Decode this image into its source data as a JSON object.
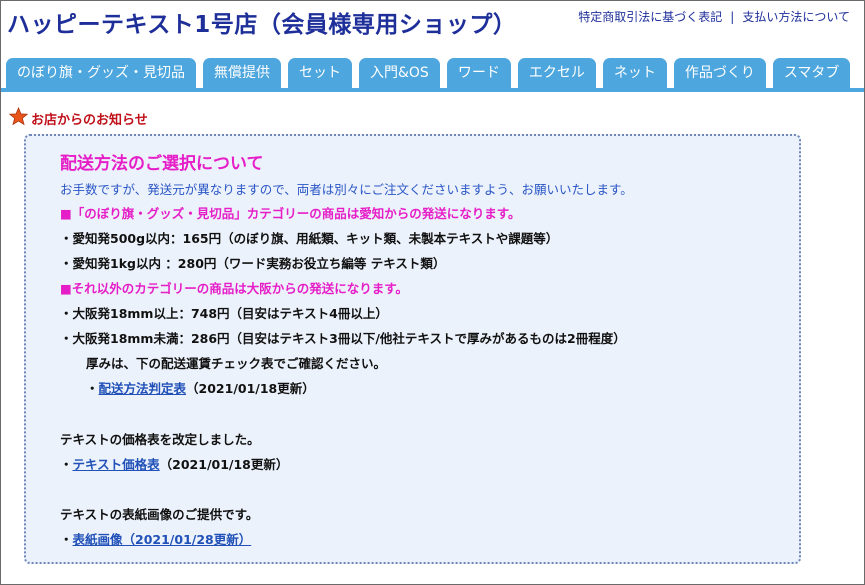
{
  "header": {
    "title": "ハッピーテキスト1号店（会員様専用ショップ）",
    "links": [
      "特定商取引法に基づく表記",
      "支払い方法について"
    ],
    "separator": "|"
  },
  "tabs": [
    "のぼり旗・グッズ・見切品",
    "無償提供",
    "セット",
    "入門&OS",
    "ワード",
    "エクセル",
    "ネット",
    "作品づくり",
    "スマタブ"
  ],
  "notice": {
    "heading": "お店からのお知らせ",
    "title": "配送方法のご選択について",
    "intro": "お手数ですが、発送元が異なりますので、両者は別々にご注文くださいますよう、お願いいたします。",
    "aichi_header": "■「のぼり旗・グッズ・見切品」カテゴリーの商品は愛知からの発送になります。",
    "aichi_500g": "・愛知発500g以内：165円（のぼり旗、用紙類、キット類、未製本テキストや課題等）",
    "aichi_1kg": "・愛知発1kg以内 ：280円（ワード実務お役立ち編等 テキスト類）",
    "osaka_header": "■それ以外のカテゴリーの商品は大阪からの発送になります。",
    "osaka_over": "・大阪発18mm以上：748円（目安はテキスト4冊以上）",
    "osaka_under": "・大阪発18mm未満：286円（目安はテキスト3冊以下/他社テキストで厚みがあるものは2冊程度）",
    "thickness_note": "厚みは、下の配送運賃チェック表でご確認ください。",
    "shipping_table_bullet": "・",
    "shipping_table_link": "配送方法判定表",
    "shipping_table_date": "（2021/01/18更新）",
    "price_revised": "テキストの価格表を改定しました。",
    "price_bullet": "・",
    "price_link": "テキスト価格表",
    "price_date": "（2021/01/18更新）",
    "cover_provided": "テキストの表紙画像のご提供です。",
    "cover_bullet": "・",
    "cover_link": "表紙画像（2021/01/28更新）"
  },
  "colors": {
    "title_blue": "#1e2f9a",
    "tab_blue": "#4da6dd",
    "heading_red": "#c0101a",
    "magenta": "#e61ec8",
    "box_bg": "#ecf2fb"
  },
  "icons": {
    "notice_icon": "star-icon"
  }
}
